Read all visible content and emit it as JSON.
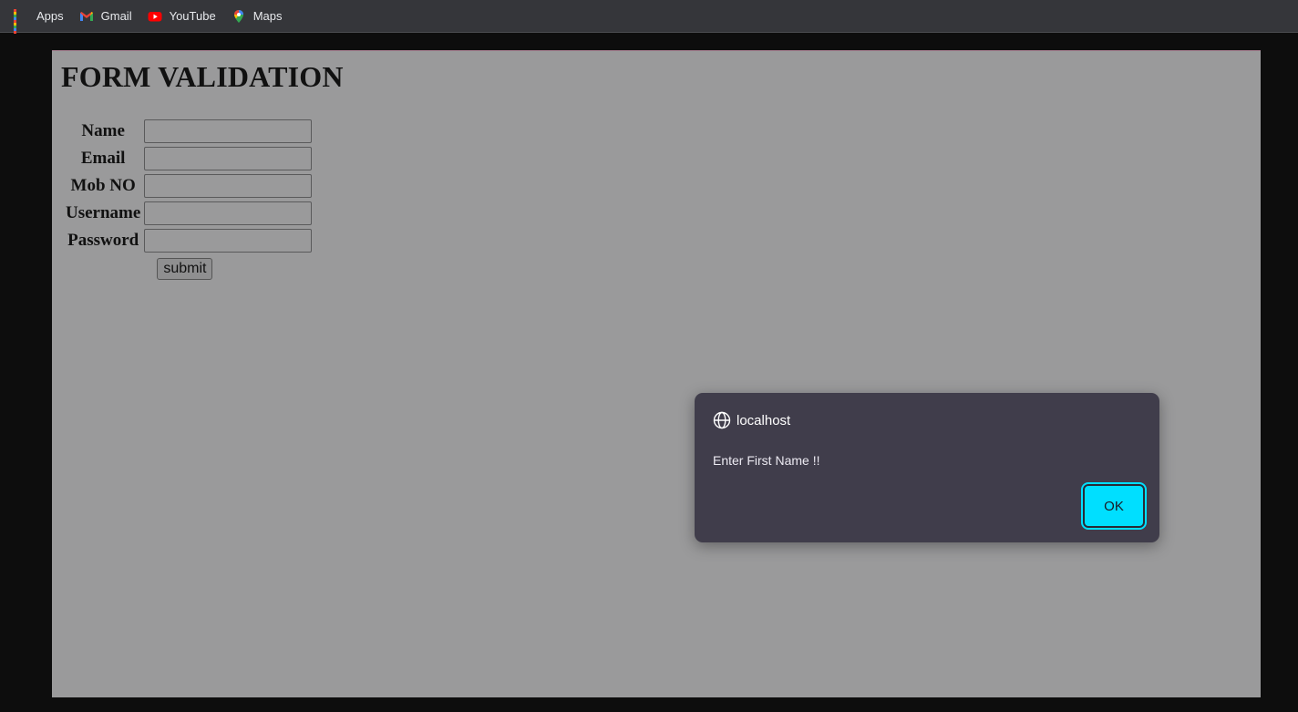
{
  "bookmarks": [
    {
      "label": "Apps",
      "icon": "apps-grid-icon"
    },
    {
      "label": "Gmail",
      "icon": "gmail-icon"
    },
    {
      "label": "YouTube",
      "icon": "youtube-icon"
    },
    {
      "label": "Maps",
      "icon": "maps-icon"
    }
  ],
  "page": {
    "title": "FORM VALIDATION",
    "fields": [
      {
        "label": "Name",
        "value": ""
      },
      {
        "label": "Email",
        "value": ""
      },
      {
        "label": "Mob NO",
        "value": ""
      },
      {
        "label": "Username",
        "value": ""
      },
      {
        "label": "Password",
        "value": ""
      }
    ],
    "submit_label": "submit"
  },
  "dialog": {
    "origin": "localhost",
    "message": "Enter First Name !!",
    "ok_label": "OK"
  },
  "colors": {
    "page_bg": "#9a9a9b",
    "dialog_bg": "#403d4b",
    "ok_accent": "#00dfff"
  }
}
